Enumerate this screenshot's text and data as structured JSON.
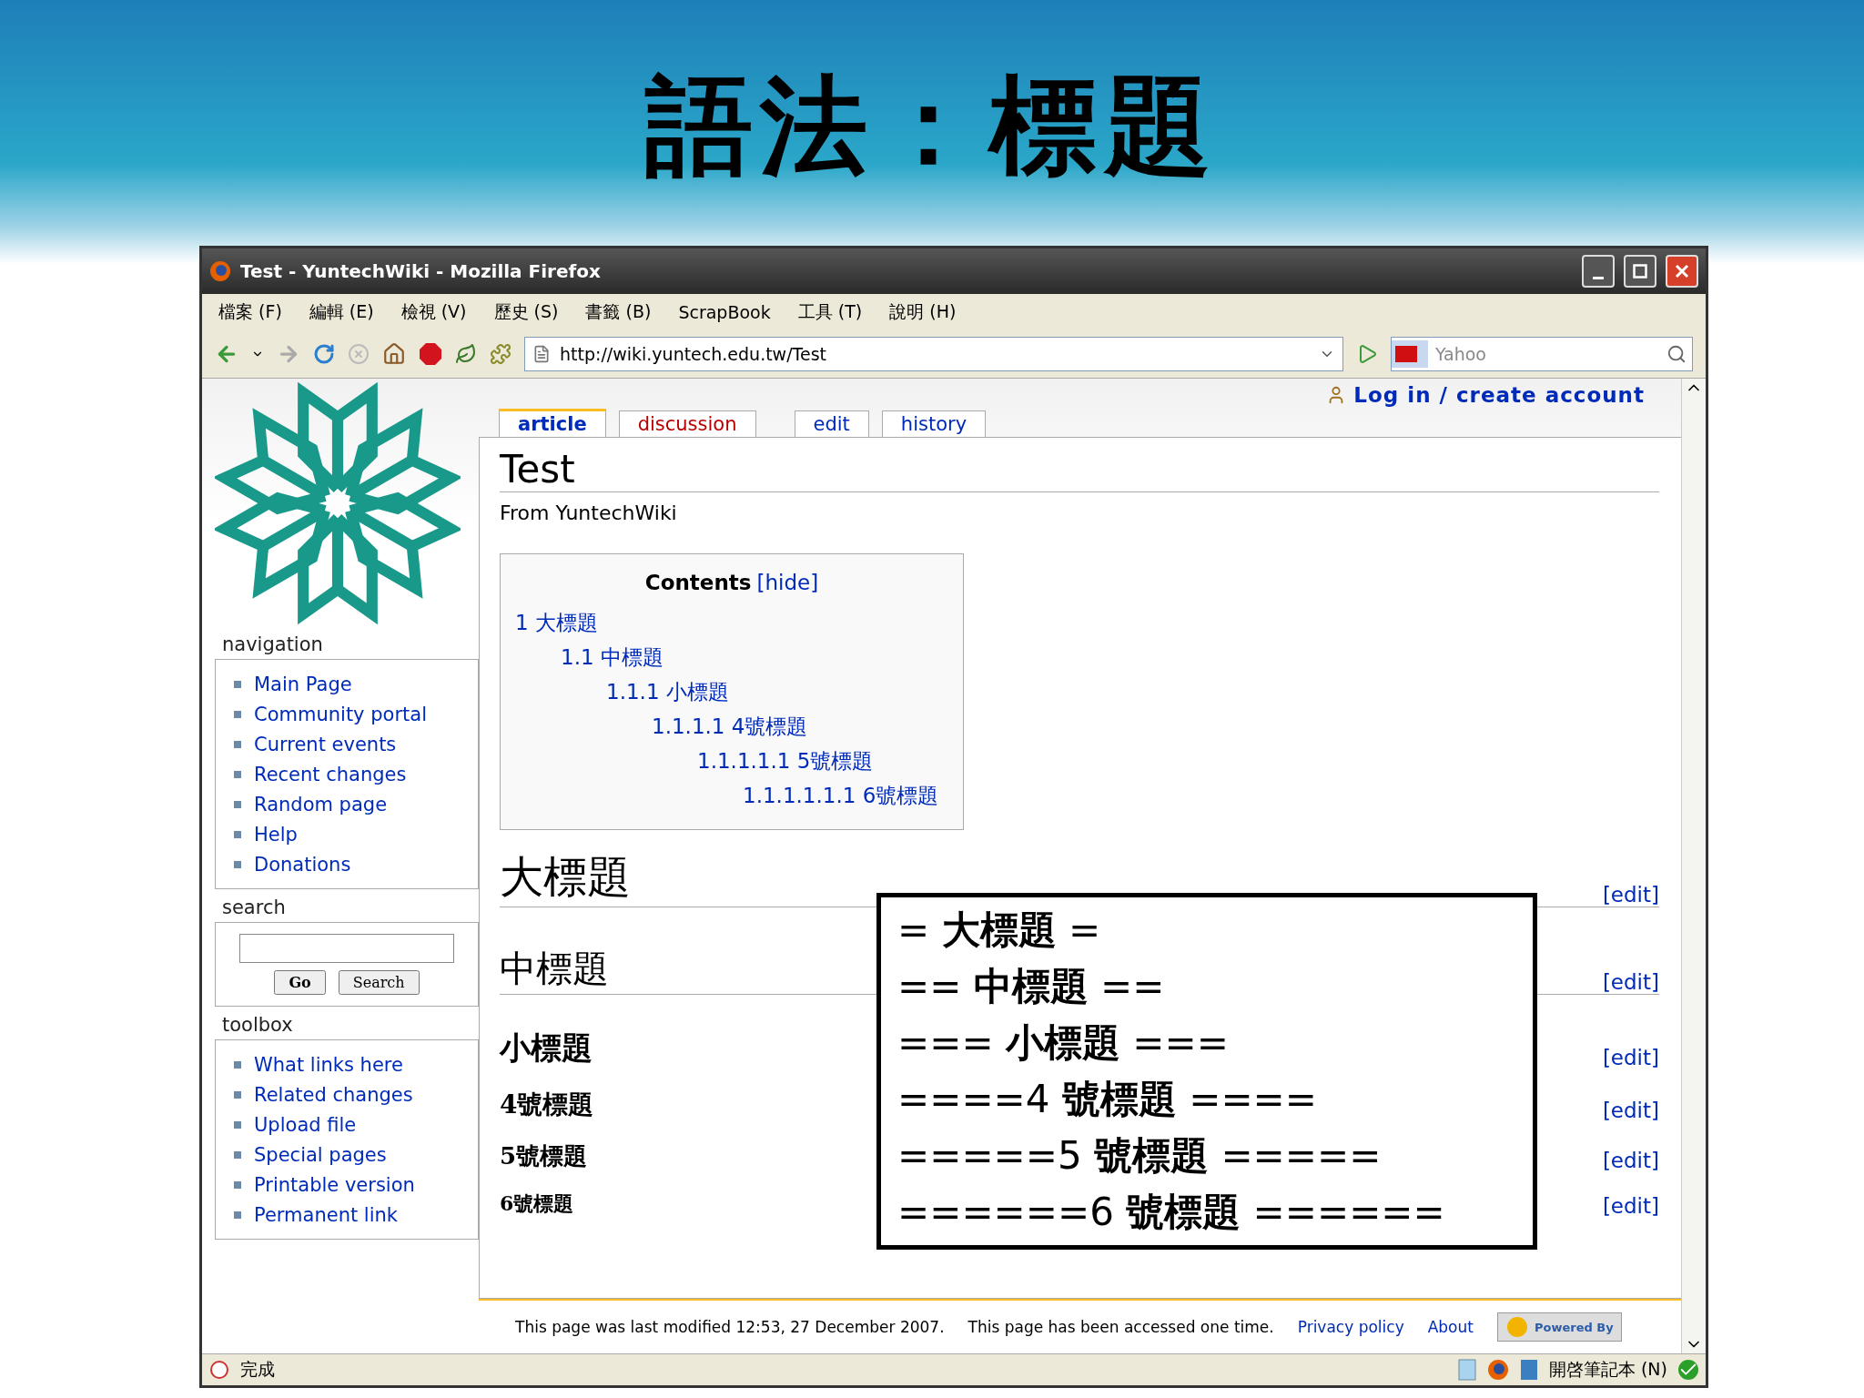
{
  "slide": {
    "title": "語法：標題"
  },
  "window": {
    "title": "Test - YuntechWiki - Mozilla Firefox"
  },
  "menu": [
    "檔案 (F)",
    "編輯 (E)",
    "檢視 (V)",
    "歷史 (S)",
    "書籤 (B)",
    "ScrapBook",
    "工具 (T)",
    "說明 (H)"
  ],
  "toolbar": {
    "url": "http://wiki.yuntech.edu.tw/Test",
    "search_placeholder": "Yahoo"
  },
  "wiki": {
    "user_link": "Log in / create account",
    "tabs": [
      {
        "label": "article",
        "selected": true,
        "missing": false
      },
      {
        "label": "discussion",
        "selected": false,
        "missing": true
      },
      {
        "label": "edit",
        "selected": false,
        "missing": false
      },
      {
        "label": "history",
        "selected": false,
        "missing": false
      }
    ],
    "page_title": "Test",
    "subtitle": "From YuntechWiki",
    "toc": {
      "title": "Contents",
      "toggle": "[hide]",
      "items": [
        {
          "number": "1",
          "text": "大標題",
          "children": [
            {
              "number": "1.1",
              "text": "中標題",
              "children": [
                {
                  "number": "1.1.1",
                  "text": "小標題",
                  "children": [
                    {
                      "number": "1.1.1.1",
                      "text": "4號標題",
                      "children": [
                        {
                          "number": "1.1.1.1.1",
                          "text": "5號標題",
                          "children": [
                            {
                              "number": "1.1.1.1.1.1",
                              "text": "6號標題"
                            }
                          ]
                        }
                      ]
                    }
                  ]
                }
              ]
            }
          ]
        }
      ]
    },
    "sections": [
      {
        "kind": "h1",
        "title": "大標題",
        "edit": "[edit]"
      },
      {
        "kind": "h2",
        "title": "中標題",
        "edit": "[edit]"
      },
      {
        "kind": "h3",
        "title": "小標題",
        "edit": "[edit]"
      },
      {
        "kind": "h4",
        "title": "4號標題",
        "edit": "[edit]"
      },
      {
        "kind": "h5",
        "title": "5號標題",
        "edit": "[edit]"
      },
      {
        "kind": "h6",
        "title": "6號標題",
        "edit": "[edit]"
      }
    ],
    "navigation": {
      "title": "navigation",
      "items": [
        "Main Page",
        "Community portal",
        "Current events",
        "Recent changes",
        "Random page",
        "Help",
        "Donations"
      ]
    },
    "search": {
      "title": "search",
      "buttons": [
        "Go",
        "Search"
      ]
    },
    "toolbox": {
      "title": "toolbox",
      "items": [
        "What links here",
        "Related changes",
        "Upload file",
        "Special pages",
        "Printable version",
        "Permanent link"
      ]
    },
    "footer": {
      "modified": "This page was last modified 12:53, 27 December 2007.",
      "accessed": "This page has been accessed one time.",
      "links": [
        "Privacy policy",
        "About"
      ],
      "badge": "Powered By"
    }
  },
  "markup_box": [
    "= **大標題** =",
    "== **中標題** ==",
    "=== **小標題** ===",
    "====4 **號標題** ====",
    "=====5 **號標題** =====",
    "======6 **號標題** ======"
  ],
  "status": {
    "text": "完成",
    "notebook": "開啓筆記本 (N)"
  }
}
